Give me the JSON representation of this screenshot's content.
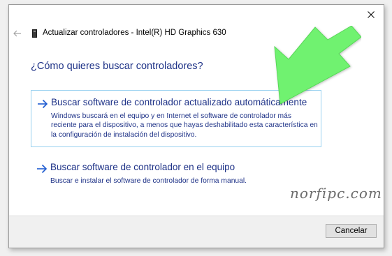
{
  "window": {
    "title": "Actualizar controladores - Intel(R) HD Graphics 630",
    "close_icon": "close-icon",
    "back_icon": "back-arrow-icon",
    "device_icon": "device-icon"
  },
  "main": {
    "heading": "¿Cómo quieres buscar controladores?",
    "options": [
      {
        "title": "Buscar software de controlador actualizado automáticamente",
        "description": "Windows buscará en el equipo y en Internet el software de controlador más reciente para el dispositivo, a menos que hayas deshabilitado esta característica en la configuración de instalación del dispositivo.",
        "icon": "arrow-right-icon",
        "highlighted": true
      },
      {
        "title": "Buscar software de controlador en el equipo",
        "description": "Buscar e instalar el software de controlador de forma manual.",
        "icon": "arrow-right-icon",
        "highlighted": false
      }
    ]
  },
  "watermark": "norfipc.com",
  "footer": {
    "cancel_label": "Cancelar"
  },
  "annotation": {
    "icon": "green-pointer-arrow-icon",
    "color": "#6ff26f"
  },
  "colors": {
    "link_blue": "#1e3287",
    "highlight_border": "#99d1f0",
    "footer_bg": "#f0f0f0"
  }
}
